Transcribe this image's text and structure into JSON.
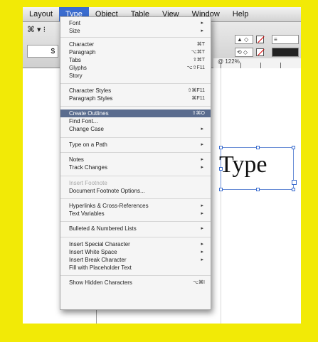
{
  "menubar": {
    "items": [
      "Layout",
      "Type",
      "Object",
      "Table",
      "View",
      "Window",
      "Help"
    ],
    "active": "Type"
  },
  "toolbar": {
    "left_label": "⌘ ▾ ⁝",
    "stroke_weight": "$",
    "zoom": "@ 122%"
  },
  "canvas": {
    "text": "Type"
  },
  "menu": {
    "items": [
      {
        "label": "Font",
        "shortcut": "",
        "submenu": true
      },
      {
        "label": "Size",
        "shortcut": "",
        "submenu": true
      },
      {
        "label": "Character",
        "shortcut": "⌘T",
        "submenu": false
      },
      {
        "label": "Paragraph",
        "shortcut": "⌥⌘T",
        "submenu": false
      },
      {
        "label": "Tabs",
        "shortcut": "⇧⌘T",
        "submenu": false
      },
      {
        "label": "Glyphs",
        "shortcut": "⌥⇧F11",
        "submenu": false
      },
      {
        "label": "Story",
        "shortcut": "",
        "submenu": false
      },
      {
        "label": "Character Styles",
        "shortcut": "⇧⌘F11",
        "submenu": false
      },
      {
        "label": "Paragraph Styles",
        "shortcut": "⌘F11",
        "submenu": false
      },
      {
        "label": "Create Outlines",
        "shortcut": "⇧⌘O",
        "submenu": false,
        "highlight": true
      },
      {
        "label": "Find Font...",
        "shortcut": "",
        "submenu": false
      },
      {
        "label": "Change Case",
        "shortcut": "",
        "submenu": true
      },
      {
        "label": "Type on a Path",
        "shortcut": "",
        "submenu": true
      },
      {
        "label": "Notes",
        "shortcut": "",
        "submenu": true
      },
      {
        "label": "Track Changes",
        "shortcut": "",
        "submenu": true
      },
      {
        "label": "Insert Footnote",
        "shortcut": "",
        "submenu": false,
        "disabled": true
      },
      {
        "label": "Document Footnote Options...",
        "shortcut": "",
        "submenu": false
      },
      {
        "label": "Hyperlinks & Cross-References",
        "shortcut": "",
        "submenu": true
      },
      {
        "label": "Text Variables",
        "shortcut": "",
        "submenu": true
      },
      {
        "label": "Bulleted & Numbered Lists",
        "shortcut": "",
        "submenu": true
      },
      {
        "label": "Insert Special Character",
        "shortcut": "",
        "submenu": true
      },
      {
        "label": "Insert White Space",
        "shortcut": "",
        "submenu": true
      },
      {
        "label": "Insert Break Character",
        "shortcut": "",
        "submenu": true
      },
      {
        "label": "Fill with Placeholder Text",
        "shortcut": "",
        "submenu": false
      },
      {
        "label": "Show Hidden Characters",
        "shortcut": "⌥⌘I",
        "submenu": false
      }
    ]
  }
}
